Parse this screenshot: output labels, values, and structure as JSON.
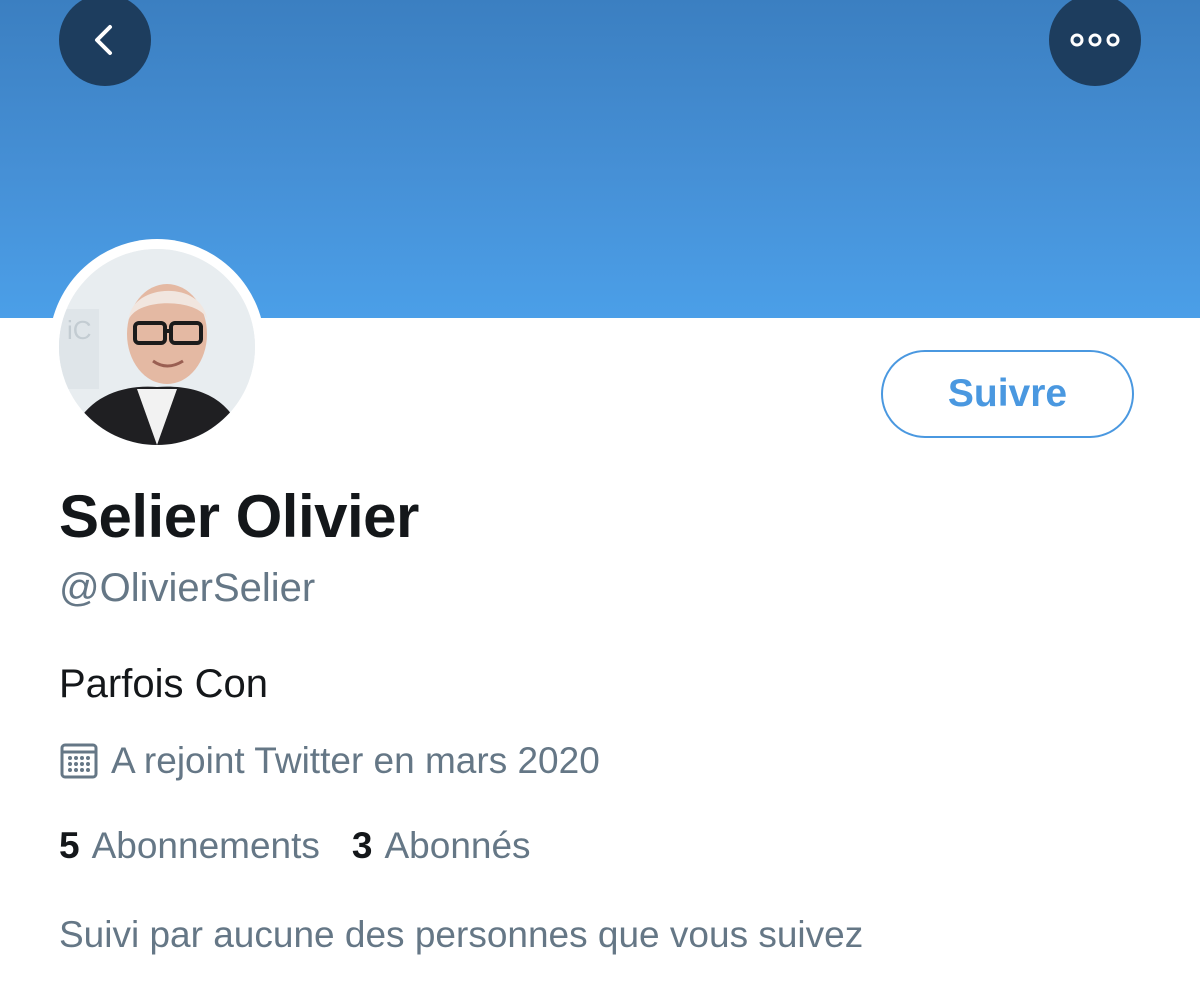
{
  "header": {
    "back_icon": "chevron-left-icon",
    "more_icon": "ellipsis-icon",
    "banner_color": "#4690d6",
    "button_color": "#1d3d5e"
  },
  "profile": {
    "name": "Selier Olivier",
    "handle": "@OlivierSelier",
    "bio": "Parfois Con",
    "joined_icon": "calendar-icon",
    "joined": "A rejoint Twitter en mars 2020",
    "follow_label": "Suivre",
    "accent_color": "#4a98e0"
  },
  "stats": {
    "following_count": "5",
    "following_label": "Abonnements",
    "followers_count": "3",
    "followers_label": "Abonnés"
  },
  "followed_by": "Suivi par aucune des personnes que vous suivez"
}
